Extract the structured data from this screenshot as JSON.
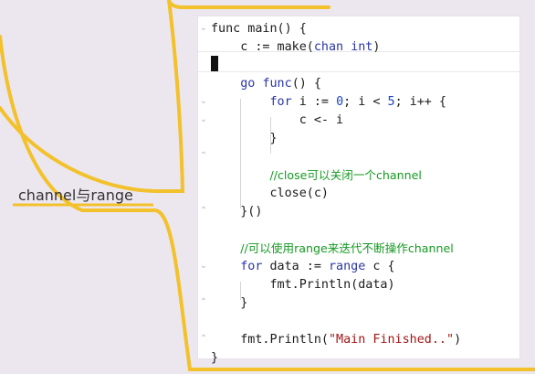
{
  "mindmap": {
    "node_label": "channel与range",
    "branch_color": "#f2c12b"
  },
  "editor": {
    "lines": [
      {
        "parts": [
          {
            "t": "func main() {",
            "c": ""
          }
        ]
      },
      {
        "parts": [
          {
            "t": "    c := make(",
            "c": ""
          },
          {
            "t": "chan",
            "c": "kw"
          },
          {
            "t": " ",
            "c": ""
          },
          {
            "t": "int",
            "c": "kw"
          },
          {
            "t": ")",
            "c": ""
          }
        ]
      },
      {
        "parts": []
      },
      {
        "parts": [
          {
            "t": "    ",
            "c": ""
          },
          {
            "t": "go",
            "c": "kw"
          },
          {
            "t": " ",
            "c": ""
          },
          {
            "t": "func",
            "c": "kw"
          },
          {
            "t": "() {",
            "c": ""
          }
        ]
      },
      {
        "parts": [
          {
            "t": "        ",
            "c": ""
          },
          {
            "t": "for",
            "c": "kw"
          },
          {
            "t": " i := ",
            "c": ""
          },
          {
            "t": "0",
            "c": "num"
          },
          {
            "t": "; i < ",
            "c": ""
          },
          {
            "t": "5",
            "c": "num"
          },
          {
            "t": "; i++ {",
            "c": ""
          }
        ]
      },
      {
        "parts": [
          {
            "t": "            c <- i",
            "c": ""
          }
        ]
      },
      {
        "parts": [
          {
            "t": "        }",
            "c": ""
          }
        ]
      },
      {
        "parts": []
      },
      {
        "parts": [
          {
            "t": "        ",
            "c": ""
          },
          {
            "t": "//close可以关闭一个channel",
            "c": "cmt"
          }
        ]
      },
      {
        "parts": [
          {
            "t": "        close(c)",
            "c": ""
          }
        ]
      },
      {
        "parts": [
          {
            "t": "    }()",
            "c": ""
          }
        ]
      },
      {
        "parts": []
      },
      {
        "parts": [
          {
            "t": "    ",
            "c": ""
          },
          {
            "t": "//可以使用range来迭代不断操作channel",
            "c": "cmt"
          }
        ]
      },
      {
        "parts": [
          {
            "t": "    ",
            "c": ""
          },
          {
            "t": "for",
            "c": "kw"
          },
          {
            "t": " data := ",
            "c": ""
          },
          {
            "t": "range",
            "c": "kw"
          },
          {
            "t": " c {",
            "c": ""
          }
        ]
      },
      {
        "parts": [
          {
            "t": "        fmt.Println(data)",
            "c": ""
          }
        ]
      },
      {
        "parts": [
          {
            "t": "    }",
            "c": ""
          }
        ]
      },
      {
        "parts": []
      },
      {
        "parts": [
          {
            "t": "    fmt.Println(",
            "c": ""
          },
          {
            "t": "\"Main Finished..\"",
            "c": "str"
          },
          {
            "t": ")",
            "c": ""
          }
        ]
      },
      {
        "parts": [
          {
            "t": "}",
            "c": ""
          }
        ]
      }
    ]
  }
}
